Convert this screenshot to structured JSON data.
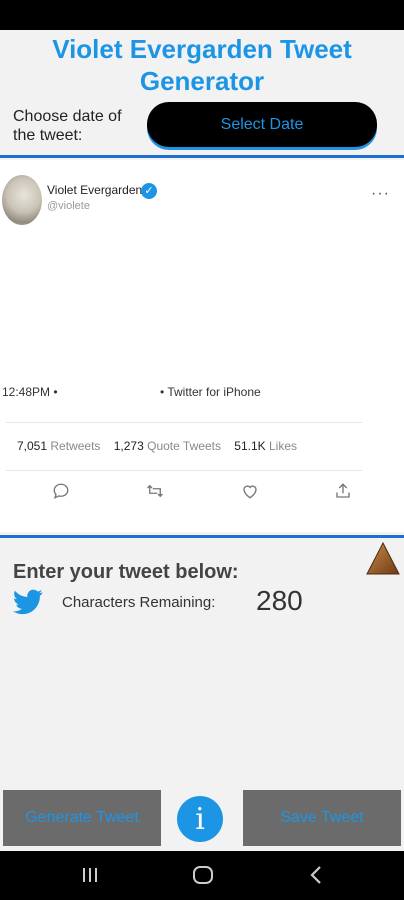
{
  "app": {
    "title": "Violet Evergarden Tweet Generator",
    "date_label": "Choose date of the tweet:",
    "select_date_label": "Select Date"
  },
  "tweet": {
    "display_name": "Violet Evergarden",
    "handle": "@violete",
    "more": "···",
    "time": "12:48PM •",
    "source": "• Twitter for iPhone",
    "retweets_count": "7,051",
    "retweets_label": "Retweets",
    "quotes_count": "1,273",
    "quotes_label": "Quote Tweets",
    "likes_count": "51.1K",
    "likes_label": "Likes",
    "actions": [
      "reply-icon",
      "retweet-icon",
      "like-icon",
      "share-icon"
    ]
  },
  "entry": {
    "heading": "Enter your tweet below:",
    "chars_label": "Characters Remaining:",
    "chars_remaining": "280"
  },
  "buttons": {
    "generate": "Generate Tweet",
    "info": "i",
    "save": "Save Tweet"
  },
  "colors": {
    "accent": "#1d95e5",
    "divider": "#1d6fd0",
    "button_bg": "#6b6b6b"
  }
}
